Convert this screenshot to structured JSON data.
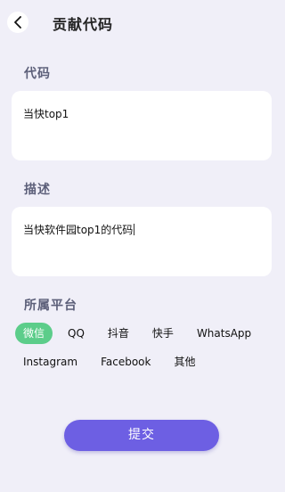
{
  "header": {
    "title": "贡献代码",
    "back_icon": "chevron-left-icon"
  },
  "code_section": {
    "label": "代码",
    "value": "当快top1"
  },
  "description_section": {
    "label": "描述",
    "value": "当快软件园top1的代码"
  },
  "platform_section": {
    "label": "所属平台",
    "selected": "微信",
    "options_row1": [
      "微信",
      "QQ",
      "抖音",
      "快手",
      "WhatsApp"
    ],
    "options_row2": [
      "Instagram",
      "Facebook",
      "其他"
    ]
  },
  "submit_label": "提交",
  "colors": {
    "accent": "#6d5fe3",
    "selected_chip": "#5ccd8a",
    "background": "#f0eff8"
  }
}
